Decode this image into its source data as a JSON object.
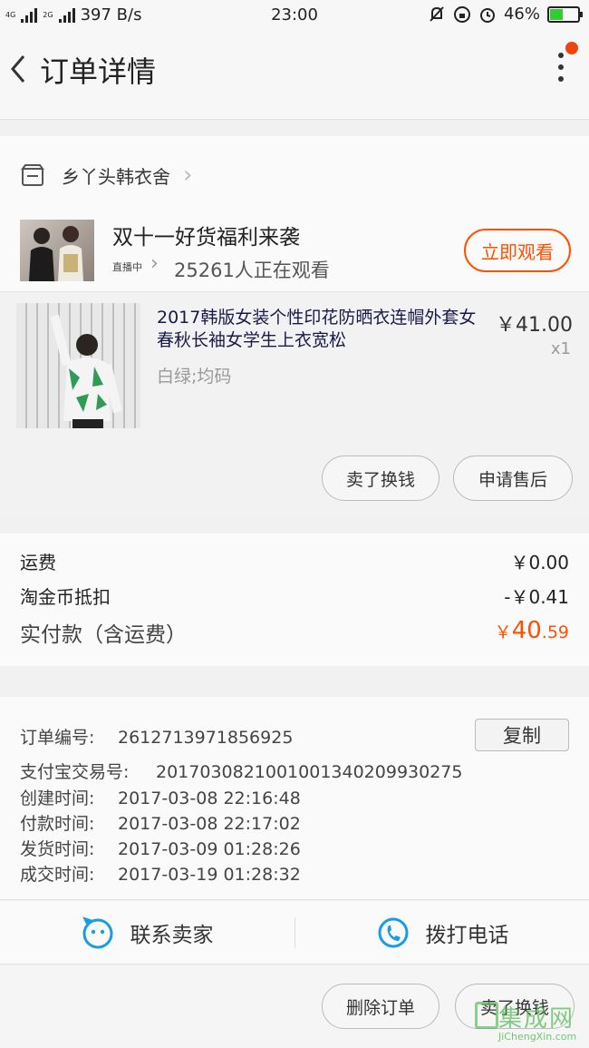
{
  "status_bar": {
    "network_1": "4G",
    "network_2": "2G",
    "speed": "397 B/s",
    "time": "23:00",
    "battery": "46%",
    "battery_level": 0.46
  },
  "header": {
    "title": "订单详情"
  },
  "shop": {
    "name": "乡丫头韩衣舍",
    "live": {
      "title": "双十一好货福利来袭",
      "status": "直播中",
      "viewers": "25261人正在观看",
      "watch_label": "立即观看"
    }
  },
  "product": {
    "title": "2017韩版女装个性印花防晒衣连帽外套女春秋长袖女学生上衣宽松",
    "sku": "白绿;均码",
    "price": "￥41.00",
    "qty": "x1",
    "sell_label": "卖了换钱",
    "aftersale_label": "申请售后"
  },
  "totals": {
    "shipping_label": "运费",
    "shipping_value": "￥0.00",
    "coin_label": "淘金币抵扣",
    "coin_value": "-￥0.41",
    "paid_label": "实付款（含运费）",
    "paid_currency": "￥",
    "paid_int": "40",
    "paid_dec": ".59"
  },
  "order_info": {
    "copy_label": "复制",
    "rows": [
      {
        "key": "订单编号:",
        "value": "2612713971856925"
      },
      {
        "key": "支付宝交易号:",
        "value": "2017030821001001340209930275"
      },
      {
        "key": "创建时间:",
        "value": "2017-03-08 22:16:48"
      },
      {
        "key": "付款时间:",
        "value": "2017-03-08 22:17:02"
      },
      {
        "key": "发货时间:",
        "value": "2017-03-09 01:28:26"
      },
      {
        "key": "成交时间:",
        "value": "2017-03-19 01:28:32"
      }
    ]
  },
  "contact": {
    "seller_label": "联系卖家",
    "call_label": "拨打电话"
  },
  "bottom": {
    "delete_label": "删除订单",
    "sell_label": "卖了换钱"
  },
  "watermark": {
    "main": "集成网",
    "sub": "JiChengXin.com"
  },
  "colors": {
    "accent": "#ff5000",
    "link_blue": "#1a9be6"
  }
}
